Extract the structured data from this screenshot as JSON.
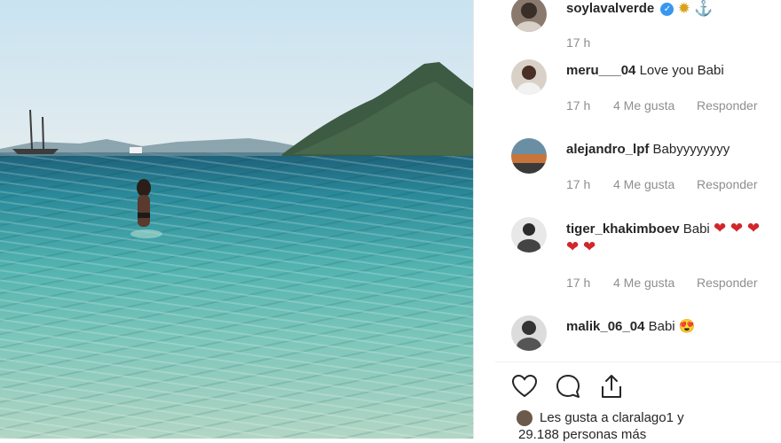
{
  "post": {
    "author": "soylavalverde",
    "author_time": "17 h",
    "icons": {
      "verified": "verified-badge-icon",
      "sun": "sun-icon",
      "anchor": "anchor-icon"
    }
  },
  "comments": [
    {
      "user": "meru___04",
      "text": "Love you Babi",
      "time": "17 h",
      "likes": "4 Me gusta",
      "reply": "Responder"
    },
    {
      "user": "alejandro_lpf",
      "text": "Babyyyyyyyy",
      "time": "17 h",
      "likes": "4 Me gusta",
      "reply": "Responder"
    },
    {
      "user": "tiger_khakimboev",
      "text": "Babi",
      "hearts_line1": "❤ ❤ ❤",
      "hearts_line2": "❤ ❤",
      "time": "17 h",
      "likes": "4 Me gusta",
      "reply": "Responder"
    },
    {
      "user": "malik_06_04",
      "text": "Babi",
      "emoji": "😍"
    }
  ],
  "actions": {
    "like": "heart-icon",
    "comment": "comment-icon",
    "share": "share-icon"
  },
  "likes_summary": {
    "line1": "Les gusta a claralago1 y",
    "line2": "29.188 personas más"
  },
  "colors": {
    "heart": "#d0262c",
    "muted": "#8e8e8e",
    "verified": "#3897f0"
  }
}
